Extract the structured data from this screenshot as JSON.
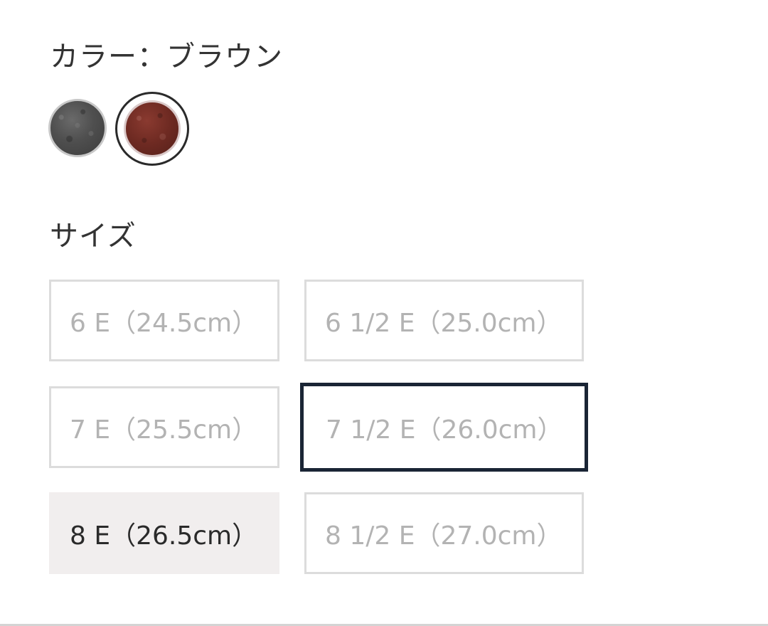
{
  "color": {
    "label": "カラー：ブラウン",
    "swatches": [
      {
        "name": "gray",
        "color": "#4f4f4f",
        "selected": false
      },
      {
        "name": "brown",
        "color": "#6e2a22",
        "selected": true
      }
    ]
  },
  "size": {
    "label": "サイズ",
    "options": [
      {
        "label": "6 E（24.5cm）",
        "state": "unavailable"
      },
      {
        "label": "6 1/2 E（25.0cm）",
        "state": "unavailable"
      },
      {
        "label": "7 E（25.5cm）",
        "state": "unavailable"
      },
      {
        "label": "7 1/2 E（26.0cm）",
        "state": "selected-unavailable"
      },
      {
        "label": "8 E（26.5cm）",
        "state": "available"
      },
      {
        "label": "8 1/2 E（27.0cm）",
        "state": "unavailable"
      }
    ]
  },
  "colors": {
    "text": "#333333",
    "unavailable_text": "#b3b3b3",
    "border": "#dcdcdc",
    "selected_border": "#1a2535",
    "available_bg": "#f1eeee"
  }
}
